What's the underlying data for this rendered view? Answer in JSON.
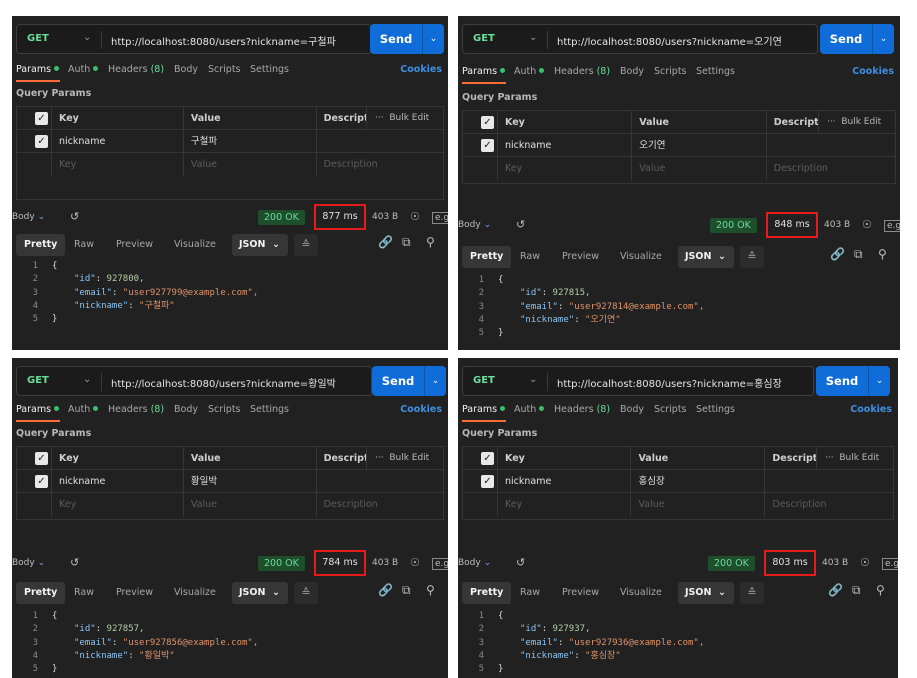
{
  "common": {
    "method": "GET",
    "send_label": "Send",
    "request_tabs": {
      "params": "Params",
      "auth": "Auth",
      "headers": "Headers",
      "headers_count": "(8)",
      "body": "Body",
      "scripts": "Scripts",
      "settings": "Settings",
      "cookies": "Cookies"
    },
    "query_params_title": "Query Params",
    "param_headers": {
      "key": "Key",
      "value": "Value",
      "description": "Descripti...",
      "bulk_edit": "Bulk Edit",
      "more": "···"
    },
    "placeholder_row": {
      "key": "Key",
      "value": "Value",
      "description": "Description"
    },
    "param_key": "nickname",
    "response_label": "Body",
    "status": "200 OK",
    "size": "403 B",
    "view_tabs": {
      "pretty": "Pretty",
      "raw": "Raw",
      "preview": "Preview",
      "visualize": "Visualize",
      "format": "JSON"
    },
    "json_keys": {
      "id": "\"id\"",
      "email": "\"email\"",
      "nickname": "\"nickname\""
    },
    "icons": {
      "send_dropdown": "chevron-down-icon",
      "history": "history-icon",
      "globe": "globe-icon",
      "save_example": "save-response-icon",
      "more": "more-icon",
      "wrap": "wrap-lines-icon",
      "link": "link-icon",
      "copy": "copy-icon",
      "search": "search-icon"
    },
    "colors": {
      "accent_orange": "#ff6c37",
      "send_blue": "#0f6cd8",
      "status_green": "#6bdd9a",
      "highlight_red": "#e51c1c"
    }
  },
  "panels": [
    {
      "url": "http://localhost:8080/users?nickname=구철파",
      "param_value": "구철파",
      "time": "877 ms",
      "response": {
        "id": "927800,",
        "email": "\"user927799@example.com\",",
        "nickname": "\"구철파\""
      }
    },
    {
      "url": "http://localhost:8080/users?nickname=오기연",
      "param_value": "오기연",
      "time": "848 ms",
      "response": {
        "id": "927815,",
        "email": "\"user927814@example.com\",",
        "nickname": "\"오기연\""
      }
    },
    {
      "url": "http://localhost:8080/users?nickname=황일박",
      "param_value": "황일박",
      "time": "784 ms",
      "response": {
        "id": "927857,",
        "email": "\"user927856@example.com\",",
        "nickname": "\"황일박\""
      }
    },
    {
      "url": "http://localhost:8080/users?nickname=홍심장",
      "param_value": "홍심장",
      "time": "803 ms",
      "response": {
        "id": "927937,",
        "email": "\"user927936@example.com\",",
        "nickname": "\"홍심장\""
      }
    }
  ]
}
